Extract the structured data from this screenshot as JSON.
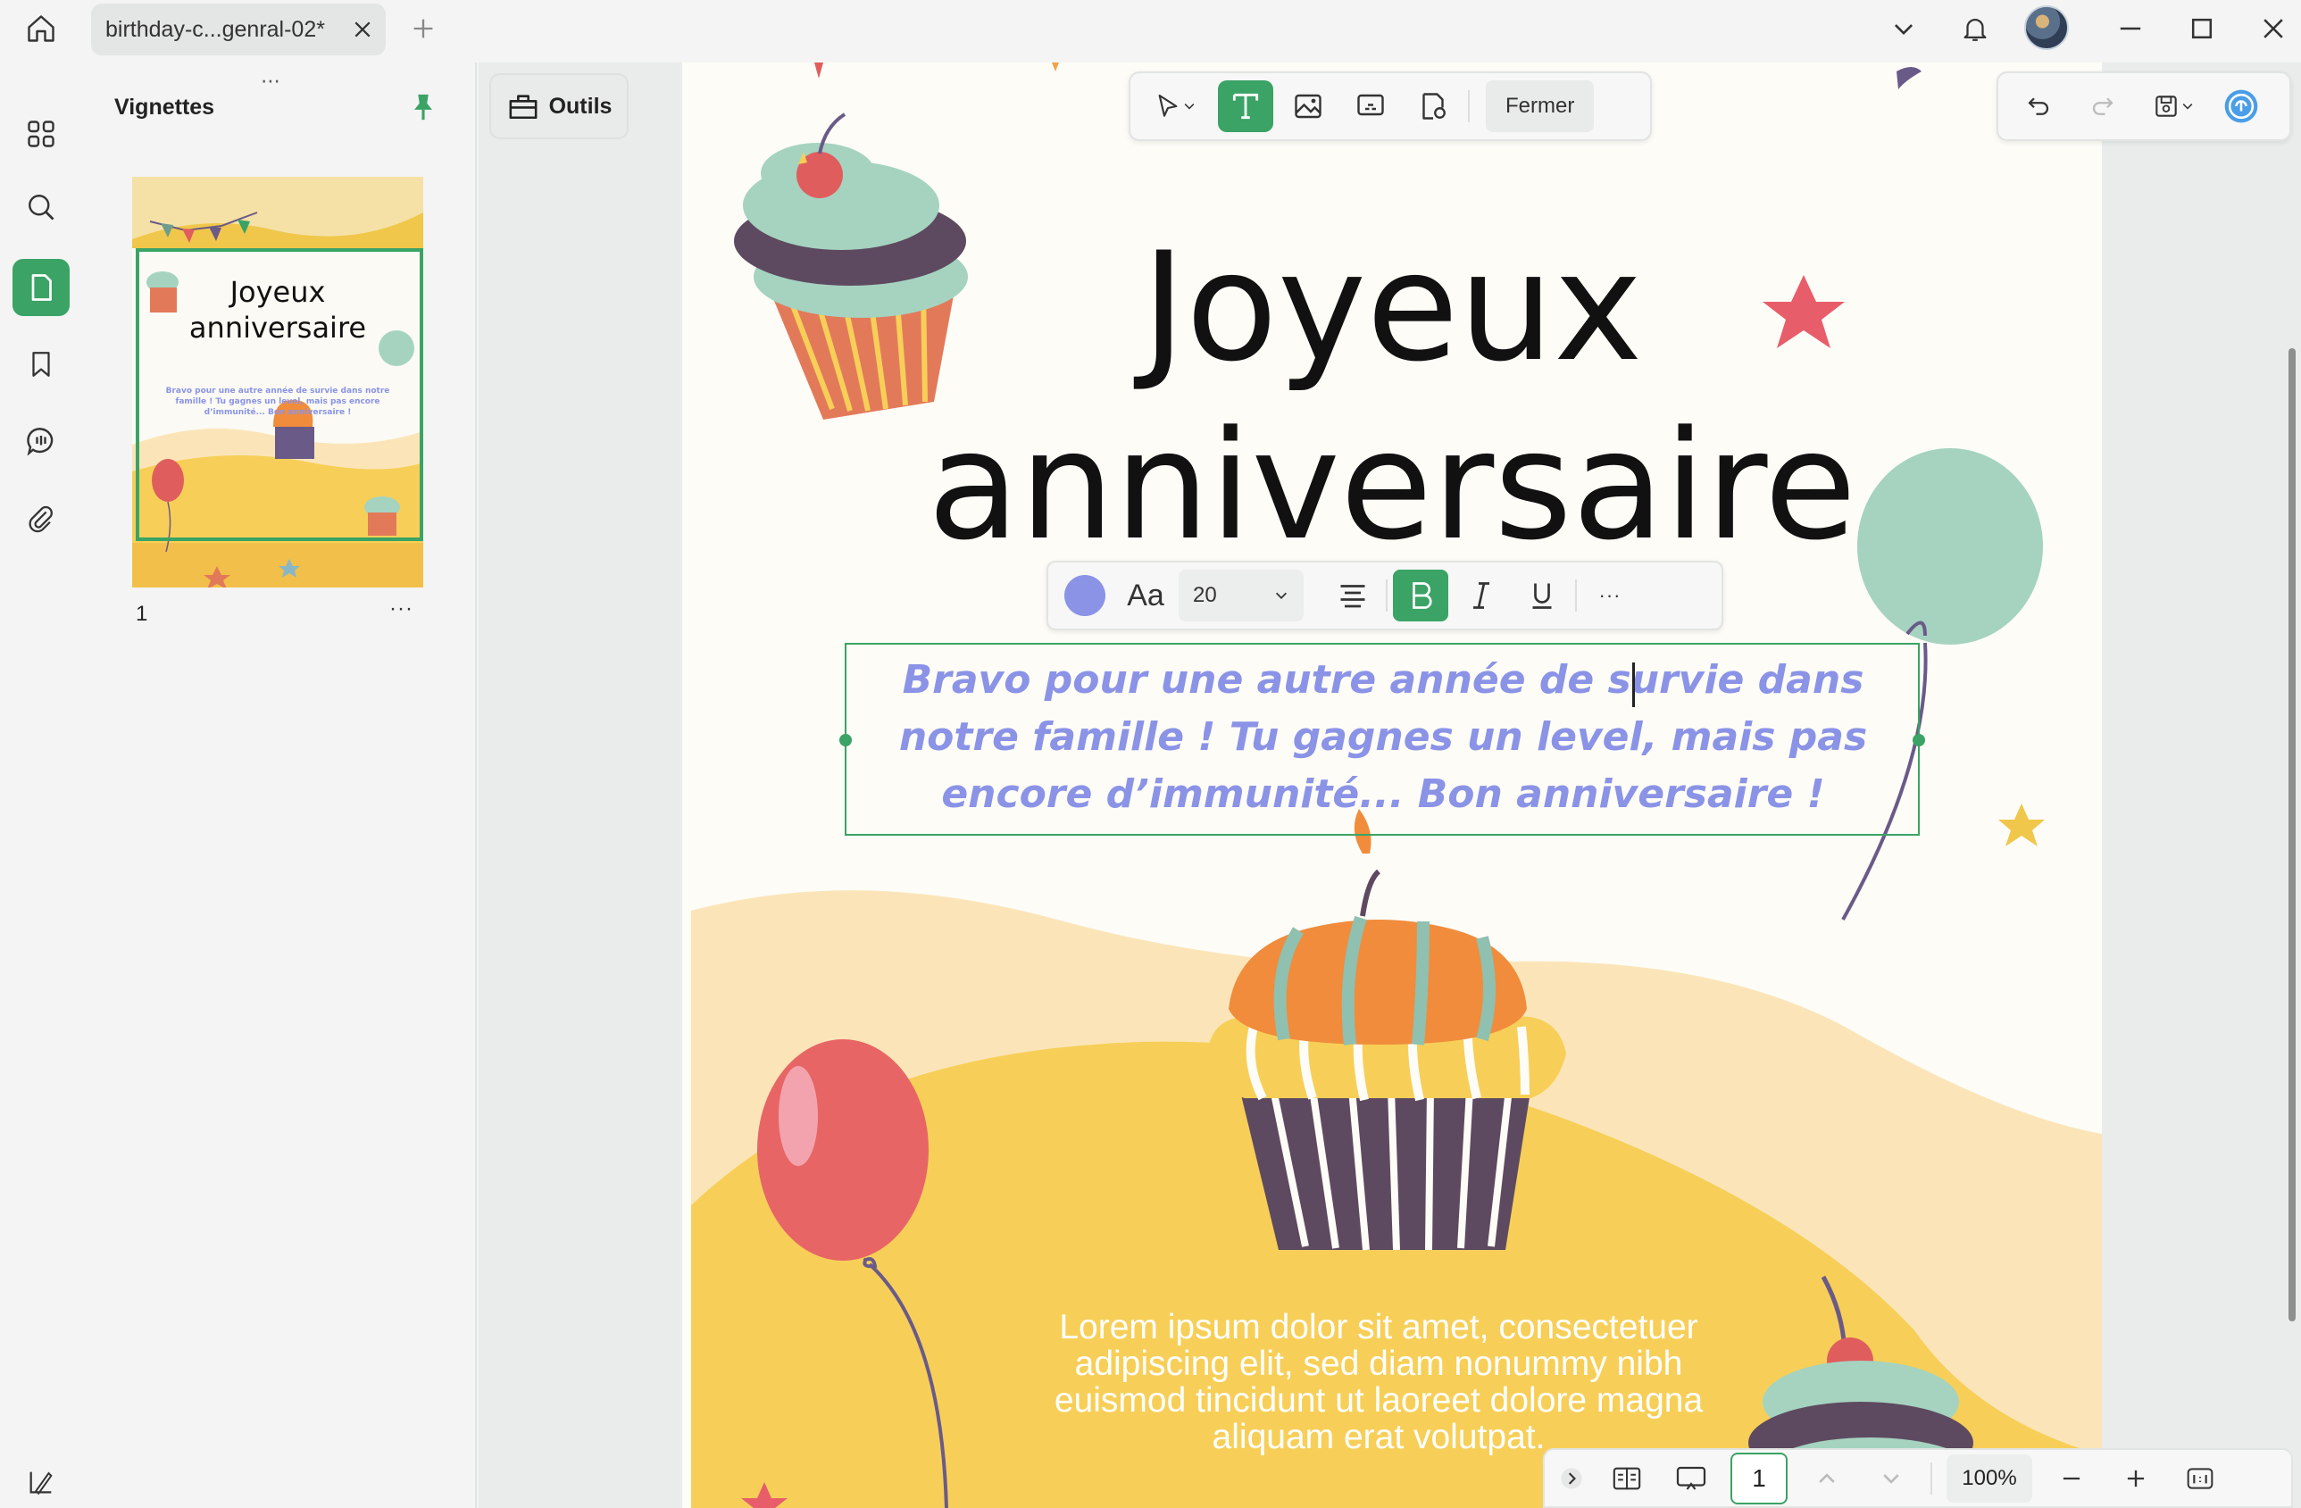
{
  "tab": {
    "title": "birthday-c...genral-02*"
  },
  "sidebar": {
    "panel_title": "Vignettes",
    "page_label": "1",
    "more_label": "···"
  },
  "thumbnail": {
    "title_line1": "Joyeux",
    "title_line2": "anniversaire"
  },
  "tools": {
    "label": "Outils"
  },
  "toolbar": {
    "close_label": "Fermer"
  },
  "format_bar": {
    "font_size": "20",
    "font_label": "Aa",
    "more_label": "···"
  },
  "document": {
    "title_line1": "Joyeux",
    "title_line2": "anniversaire",
    "edited_text": "Bravo pour une autre année de survie dans notre famille ! Tu gagnes un level, mais pas encore d’immunité... Bon anniversaire !",
    "lorem_text": "Lorem ipsum dolor sit amet, consectetuer adipiscing elit, sed diam nonummy nibh euismod tincidunt ut laoreet dolore magna aliquam erat volutpat."
  },
  "status": {
    "page_number": "1",
    "zoom": "100%"
  },
  "colors": {
    "accent": "#3aa365",
    "text_color": "#8a93e6"
  }
}
